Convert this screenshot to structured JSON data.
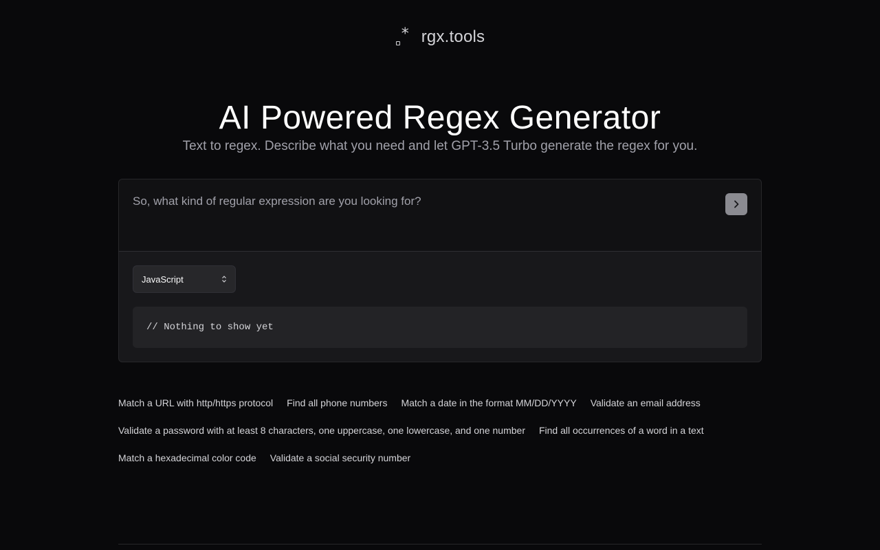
{
  "header": {
    "logo_icon": "regex-dot-star-icon",
    "logo_text": "rgx.tools"
  },
  "hero": {
    "title": "AI Powered Regex Generator",
    "subtitle": "Text to regex. Describe what you need and let GPT-3.5 Turbo generate the regex for you."
  },
  "prompt": {
    "placeholder": "So, what kind of regular expression are you looking for?",
    "value": "",
    "submit_icon": "chevron-right-icon"
  },
  "language_select": {
    "selected": "JavaScript",
    "icon": "chevron-up-down-icon"
  },
  "output": {
    "text": "// Nothing to show yet"
  },
  "suggestions": [
    [
      "Match a URL with http/https protocol",
      "Find all phone numbers",
      "Match a date in the format MM/DD/YYYY",
      "Validate an email address"
    ],
    [
      "Validate a password with at least 8 characters, one uppercase, one lowercase, and one number",
      "Find all occurrences of a word in a text"
    ],
    [
      "Match a hexadecimal color code",
      "Validate a social security number"
    ]
  ],
  "colors": {
    "background": "#09090b",
    "card": "#18181b",
    "submit_button": "#8b8b91"
  }
}
